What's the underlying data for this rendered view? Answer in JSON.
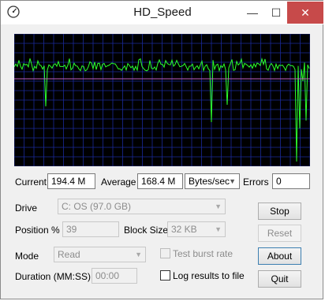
{
  "window": {
    "title": "HD_Speed",
    "minimize_glyph": "—",
    "maximize_glyph": "☐",
    "close_glyph": "✕"
  },
  "graph": {
    "background": "#000000",
    "grid_color": "#1a2a9a",
    "line_color": "#2cff2c",
    "average_line_color": "#c060c0",
    "baseline_y": 194.4,
    "average_y": 168.4
  },
  "readout": {
    "current_label": "Current",
    "current_value": "194.4 M",
    "average_label": "Average",
    "average_value": "168.4 M",
    "units_value": "Bytes/sec",
    "errors_label": "Errors",
    "errors_value": "0"
  },
  "settings": {
    "drive_label": "Drive",
    "drive_value": "C: OS (97.0 GB)",
    "position_label": "Position %",
    "position_value": "39",
    "block_size_label": "Block Size",
    "block_size_value": "32 KB",
    "mode_label": "Mode",
    "mode_value": "Read",
    "burst_label": "Test burst rate",
    "duration_label": "Duration (MM:SS)",
    "duration_value": "00:00",
    "log_label": "Log results to file"
  },
  "buttons": {
    "stop": "Stop",
    "reset": "Reset",
    "about": "About",
    "quit": "Quit"
  },
  "icons": {
    "app": "gauge-icon",
    "dropdown": "chevron-down-icon"
  }
}
